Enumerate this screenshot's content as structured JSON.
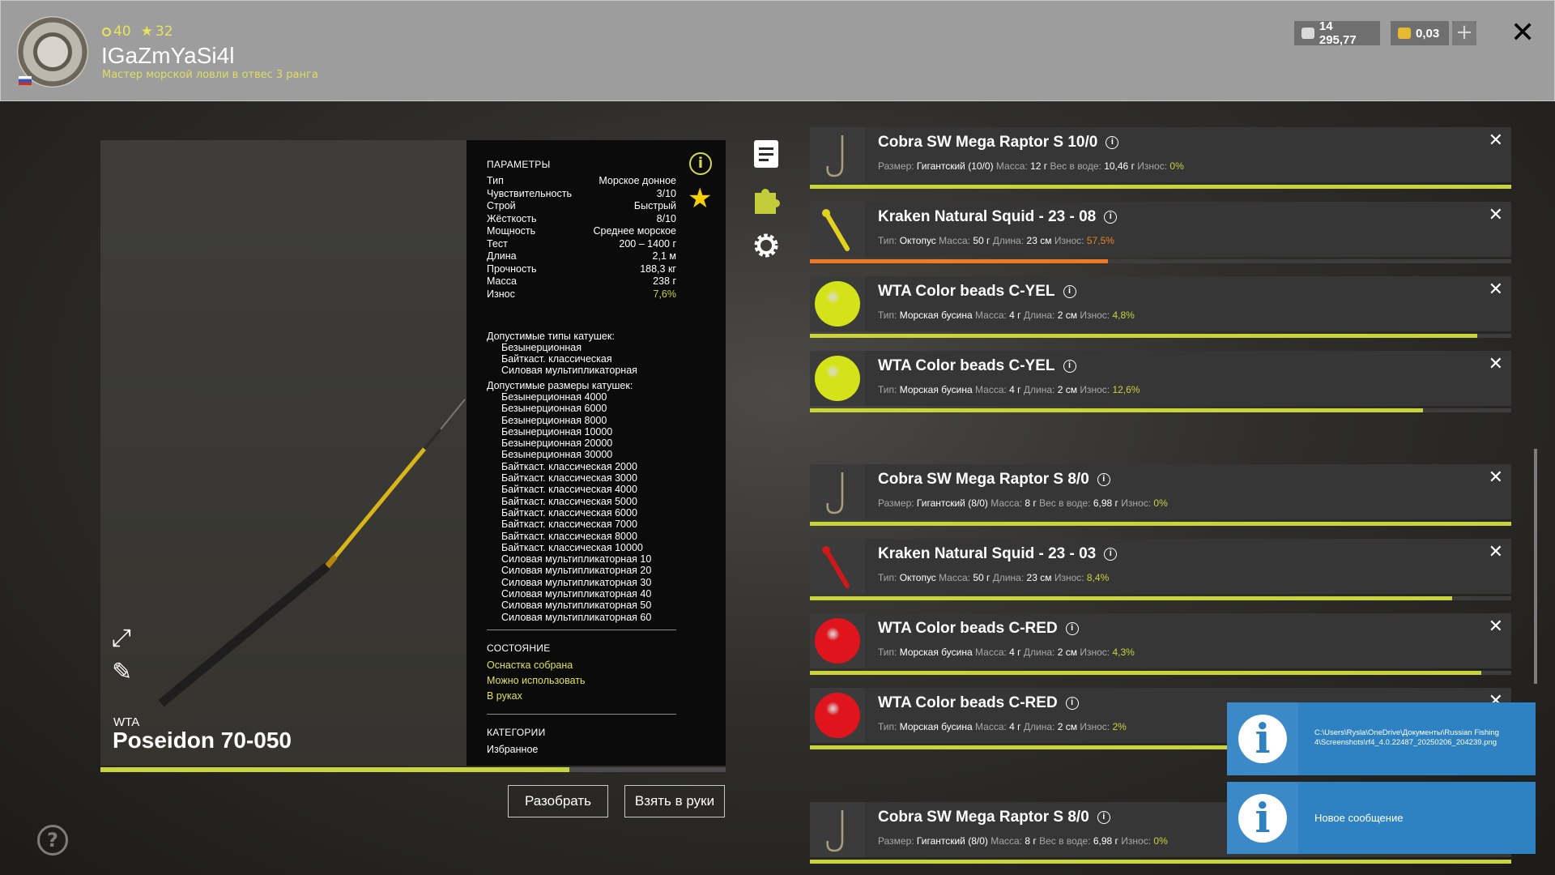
{
  "header": {
    "level": "40",
    "stars": "32",
    "player_name": "IGaZmYaSi4l",
    "rank": "Мастер морской ловли в отвес 3 ранга",
    "silver": "14 295,77",
    "gold": "0,03"
  },
  "rod": {
    "brand": "WTA",
    "name": "Poseidon 70-050",
    "wear_fraction": 0.75
  },
  "params": {
    "heading": "ПАРАМЕТРЫ",
    "rows": [
      {
        "label": "Тип",
        "value": "Морское донное"
      },
      {
        "label": "Чувствительность",
        "value": "3/10"
      },
      {
        "label": "Строй",
        "value": "Быстрый"
      },
      {
        "label": "Жёсткость",
        "value": "8/10"
      },
      {
        "label": "Мощность",
        "value": "Среднее морское"
      },
      {
        "label": "Тест",
        "value": "200 – 1400 г"
      },
      {
        "label": "Длина",
        "value": "2,1 м"
      },
      {
        "label": "Прочность",
        "value": "188,3 кг"
      },
      {
        "label": "Масса",
        "value": "238 г"
      },
      {
        "label": "Износ",
        "value": "7,6%"
      }
    ],
    "reel_types_heading": "Допустимые типы катушек:",
    "reel_types": [
      "Безынерционная",
      "Байткаст. классическая",
      "Силовая мультипликаторная"
    ],
    "reel_sizes_heading": "Допустимые размеры катушек:",
    "reel_sizes": [
      "Безынерционная 4000",
      "Безынерционная 6000",
      "Безынерционная 8000",
      "Безынерционная 10000",
      "Безынерционная 20000",
      "Безынерционная 30000",
      "Байткаст. классическая 2000",
      "Байткаст. классическая 3000",
      "Байткаст. классическая 4000",
      "Байткаст. классическая 5000",
      "Байткаст. классическая 6000",
      "Байткаст. классическая 7000",
      "Байткаст. классическая 8000",
      "Байткаст. классическая 10000",
      "Силовая мультипликаторная 10",
      "Силовая мультипликаторная 20",
      "Силовая мультипликаторная 30",
      "Силовая мультипликаторная 40",
      "Силовая мультипликаторная 50",
      "Силовая мультипликаторная 60"
    ],
    "state_heading": "СОСТОЯНИЕ",
    "state": [
      "Оснастка собрана",
      "Можно использовать",
      "В руках"
    ],
    "category_heading": "КАТЕГОРИИ",
    "category": "Избранное"
  },
  "buttons": {
    "disassemble": "Разобрать",
    "take": "Взять в руки"
  },
  "tackle": [
    {
      "title": "Cobra SW Mega Raptor S 10/0",
      "icon": "hook",
      "wear_fraction": 1.0,
      "wear_color": "green",
      "meta": [
        {
          "k": "Размер:",
          "v": "Гигантский (10/0)"
        },
        {
          "k": "Масса:",
          "v": "12 г"
        },
        {
          "k": "Вес в воде:",
          "v": "10,46 г"
        },
        {
          "k": "Износ:",
          "w": "0%"
        }
      ]
    },
    {
      "title": "Kraken Natural Squid - 23 - 08",
      "icon": "squid-yellow",
      "wear_fraction": 0.425,
      "wear_color": "orange",
      "meta": [
        {
          "k": "Тип:",
          "v": "Октопус"
        },
        {
          "k": "Масса:",
          "v": "50 г"
        },
        {
          "k": "Длина:",
          "v": "23 см"
        },
        {
          "k": "Износ:",
          "w": "57,5%",
          "high": true
        }
      ]
    },
    {
      "title": "WTA Color beads C-YEL",
      "icon": "bead-yellow",
      "wear_fraction": 0.952,
      "wear_color": "green",
      "meta": [
        {
          "k": "Тип:",
          "v": "Морская бусина"
        },
        {
          "k": "Масса:",
          "v": "4 г"
        },
        {
          "k": "Длина:",
          "v": "2 см"
        },
        {
          "k": "Износ:",
          "w": "4,8%"
        }
      ]
    },
    {
      "title": "WTA Color beads C-YEL",
      "icon": "bead-yellow",
      "wear_fraction": 0.874,
      "wear_color": "green",
      "meta": [
        {
          "k": "Тип:",
          "v": "Морская бусина"
        },
        {
          "k": "Масса:",
          "v": "4 г"
        },
        {
          "k": "Длина:",
          "v": "2 см"
        },
        {
          "k": "Износ:",
          "w": "12,6%"
        }
      ]
    },
    {
      "title": "Cobra SW Mega Raptor S 8/0",
      "icon": "hook",
      "wear_fraction": 1.0,
      "wear_color": "green",
      "meta": [
        {
          "k": "Размер:",
          "v": "Гигантский (8/0)"
        },
        {
          "k": "Масса:",
          "v": "8 г"
        },
        {
          "k": "Вес в воде:",
          "v": "6,98 г"
        },
        {
          "k": "Износ:",
          "w": "0%"
        }
      ]
    },
    {
      "title": "Kraken Natural Squid - 23 - 03",
      "icon": "squid-red",
      "wear_fraction": 0.916,
      "wear_color": "green",
      "meta": [
        {
          "k": "Тип:",
          "v": "Октопус"
        },
        {
          "k": "Масса:",
          "v": "50 г"
        },
        {
          "k": "Длина:",
          "v": "23 см"
        },
        {
          "k": "Износ:",
          "w": "8,4%"
        }
      ]
    },
    {
      "title": "WTA Color beads C-RED",
      "icon": "bead-red",
      "wear_fraction": 0.957,
      "wear_color": "green",
      "meta": [
        {
          "k": "Тип:",
          "v": "Морская бусина"
        },
        {
          "k": "Масса:",
          "v": "4 г"
        },
        {
          "k": "Длина:",
          "v": "2 см"
        },
        {
          "k": "Износ:",
          "w": "4,3%"
        }
      ]
    },
    {
      "title": "WTA Color beads C-RED",
      "icon": "bead-red",
      "wear_fraction": 0.98,
      "wear_color": "green",
      "meta": [
        {
          "k": "Тип:",
          "v": "Морская бусина"
        },
        {
          "k": "Масса:",
          "v": "4 г"
        },
        {
          "k": "Длина:",
          "v": "2 см"
        },
        {
          "k": "Износ:",
          "w": "2%"
        }
      ]
    },
    {
      "title": "Cobra SW Mega Raptor S 8/0",
      "icon": "hook",
      "wear_fraction": 1.0,
      "wear_color": "green",
      "meta": [
        {
          "k": "Размер:",
          "v": "Гигантский (8/0)"
        },
        {
          "k": "Масса:",
          "v": "8 г"
        },
        {
          "k": "Вес в воде:",
          "v": "6,98 г"
        },
        {
          "k": "Износ:",
          "w": "0%"
        }
      ]
    }
  ],
  "notifications": {
    "screenshot_path_line1": "C:\\Users\\Rysla\\OneDrive\\Документы\\Russian Fishing",
    "screenshot_path_line2": "4\\Screenshots\\rf4_4.0.22487_20250206_204239.png",
    "new_message": "Новое сообщение"
  },
  "colors": {
    "accent": "#c9d33a",
    "wear_high": "#ef7a25",
    "notify": "#2f82c1"
  }
}
